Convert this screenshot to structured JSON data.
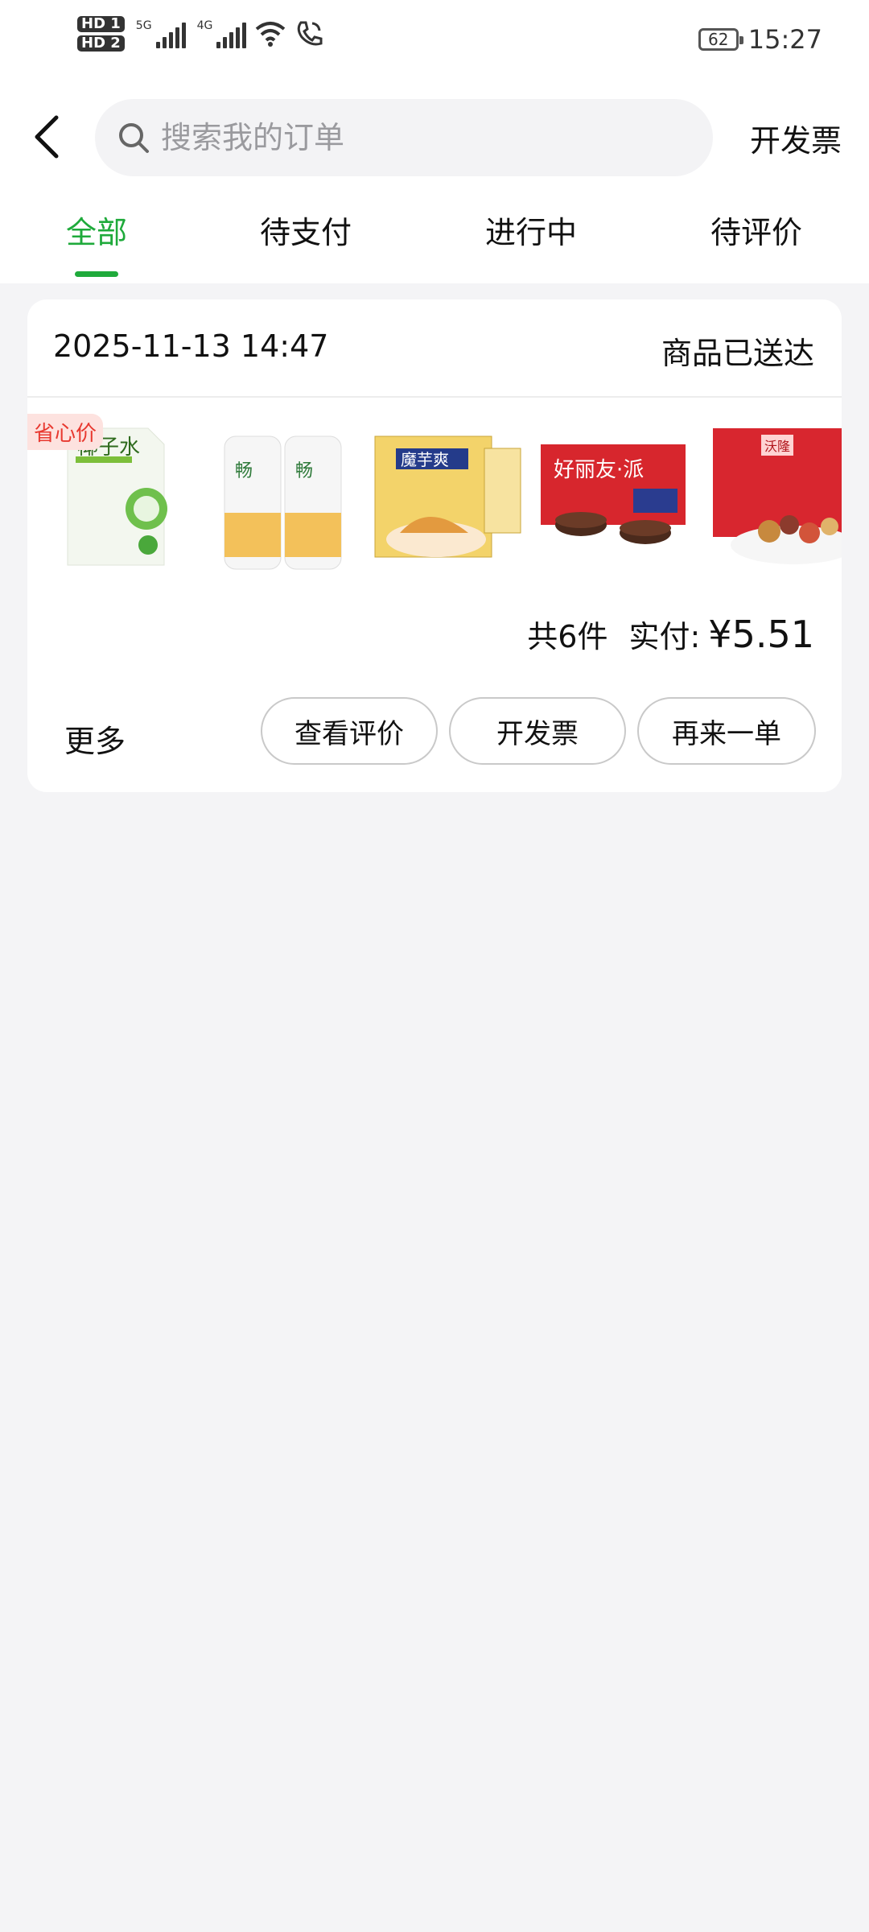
{
  "status_bar": {
    "sim1": "HD 1",
    "sim2": "HD 2",
    "net1": "5G",
    "net2": "4G",
    "battery": "62",
    "time": "15:27",
    "icons": [
      "signal-icon",
      "wifi-icon",
      "call-icon"
    ]
  },
  "header": {
    "search_placeholder": "搜索我的订单",
    "invoice_link": "开发票"
  },
  "tabs": [
    {
      "label": "全部",
      "active": true
    },
    {
      "label": "待支付",
      "active": false
    },
    {
      "label": "进行中",
      "active": false
    },
    {
      "label": "待评价",
      "active": false
    }
  ],
  "order": {
    "time": "2025-11-13 14:47",
    "status": "商品已送达",
    "badge": "省心价",
    "product_text": {
      "coconut": "椰子水",
      "chips": "魔芋爽",
      "cake": "好丽友·派",
      "nuts_brand": "沃隆"
    },
    "count_text": "共6件",
    "paid_label": "实付:",
    "amount": "¥5.51",
    "more_label": "更多",
    "buttons": {
      "review": "查看评价",
      "invoice": "开发票",
      "reorder": "再来一单"
    }
  },
  "colors": {
    "accent": "#1faa3b",
    "badge_text": "#e8382f",
    "background": "#f4f4f6"
  }
}
